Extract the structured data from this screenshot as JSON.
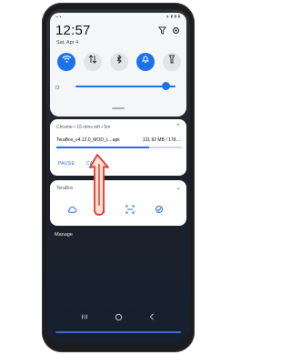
{
  "status_bar": {
    "left_text": "⌁ ▪",
    "right_text": "⏵ ▮▮▮"
  },
  "header": {
    "time": "12:57",
    "date": "Sat, Apr 4",
    "filter_icon": "funnel-icon",
    "settings_icon": "gear-icon"
  },
  "quick_settings": [
    {
      "name": "wifi",
      "icon": "wifi-icon",
      "active": true
    },
    {
      "name": "data",
      "icon": "mobile-data-icon",
      "active": false
    },
    {
      "name": "bluetooth",
      "icon": "bluetooth-icon",
      "active": false
    },
    {
      "name": "notifications",
      "icon": "bell-icon",
      "active": true
    },
    {
      "name": "flashlight",
      "icon": "flashlight-icon",
      "active": false
    }
  ],
  "brightness": {
    "level": 0.9
  },
  "download": {
    "app_line": "Chrome • 15 mins left • 5m",
    "file_name": "TeraBox_v4.12.0_MOD_t....apk",
    "size_text": "131.92 MB / 178....",
    "progress": 0.74,
    "pause_label": "PAUSE",
    "cancel_label": "CANCEL"
  },
  "terabox": {
    "app_label": "TeraBox"
  },
  "manage_label": "Manage",
  "colors": {
    "accent": "#1a73e8",
    "annotation_red": "#e53935"
  }
}
